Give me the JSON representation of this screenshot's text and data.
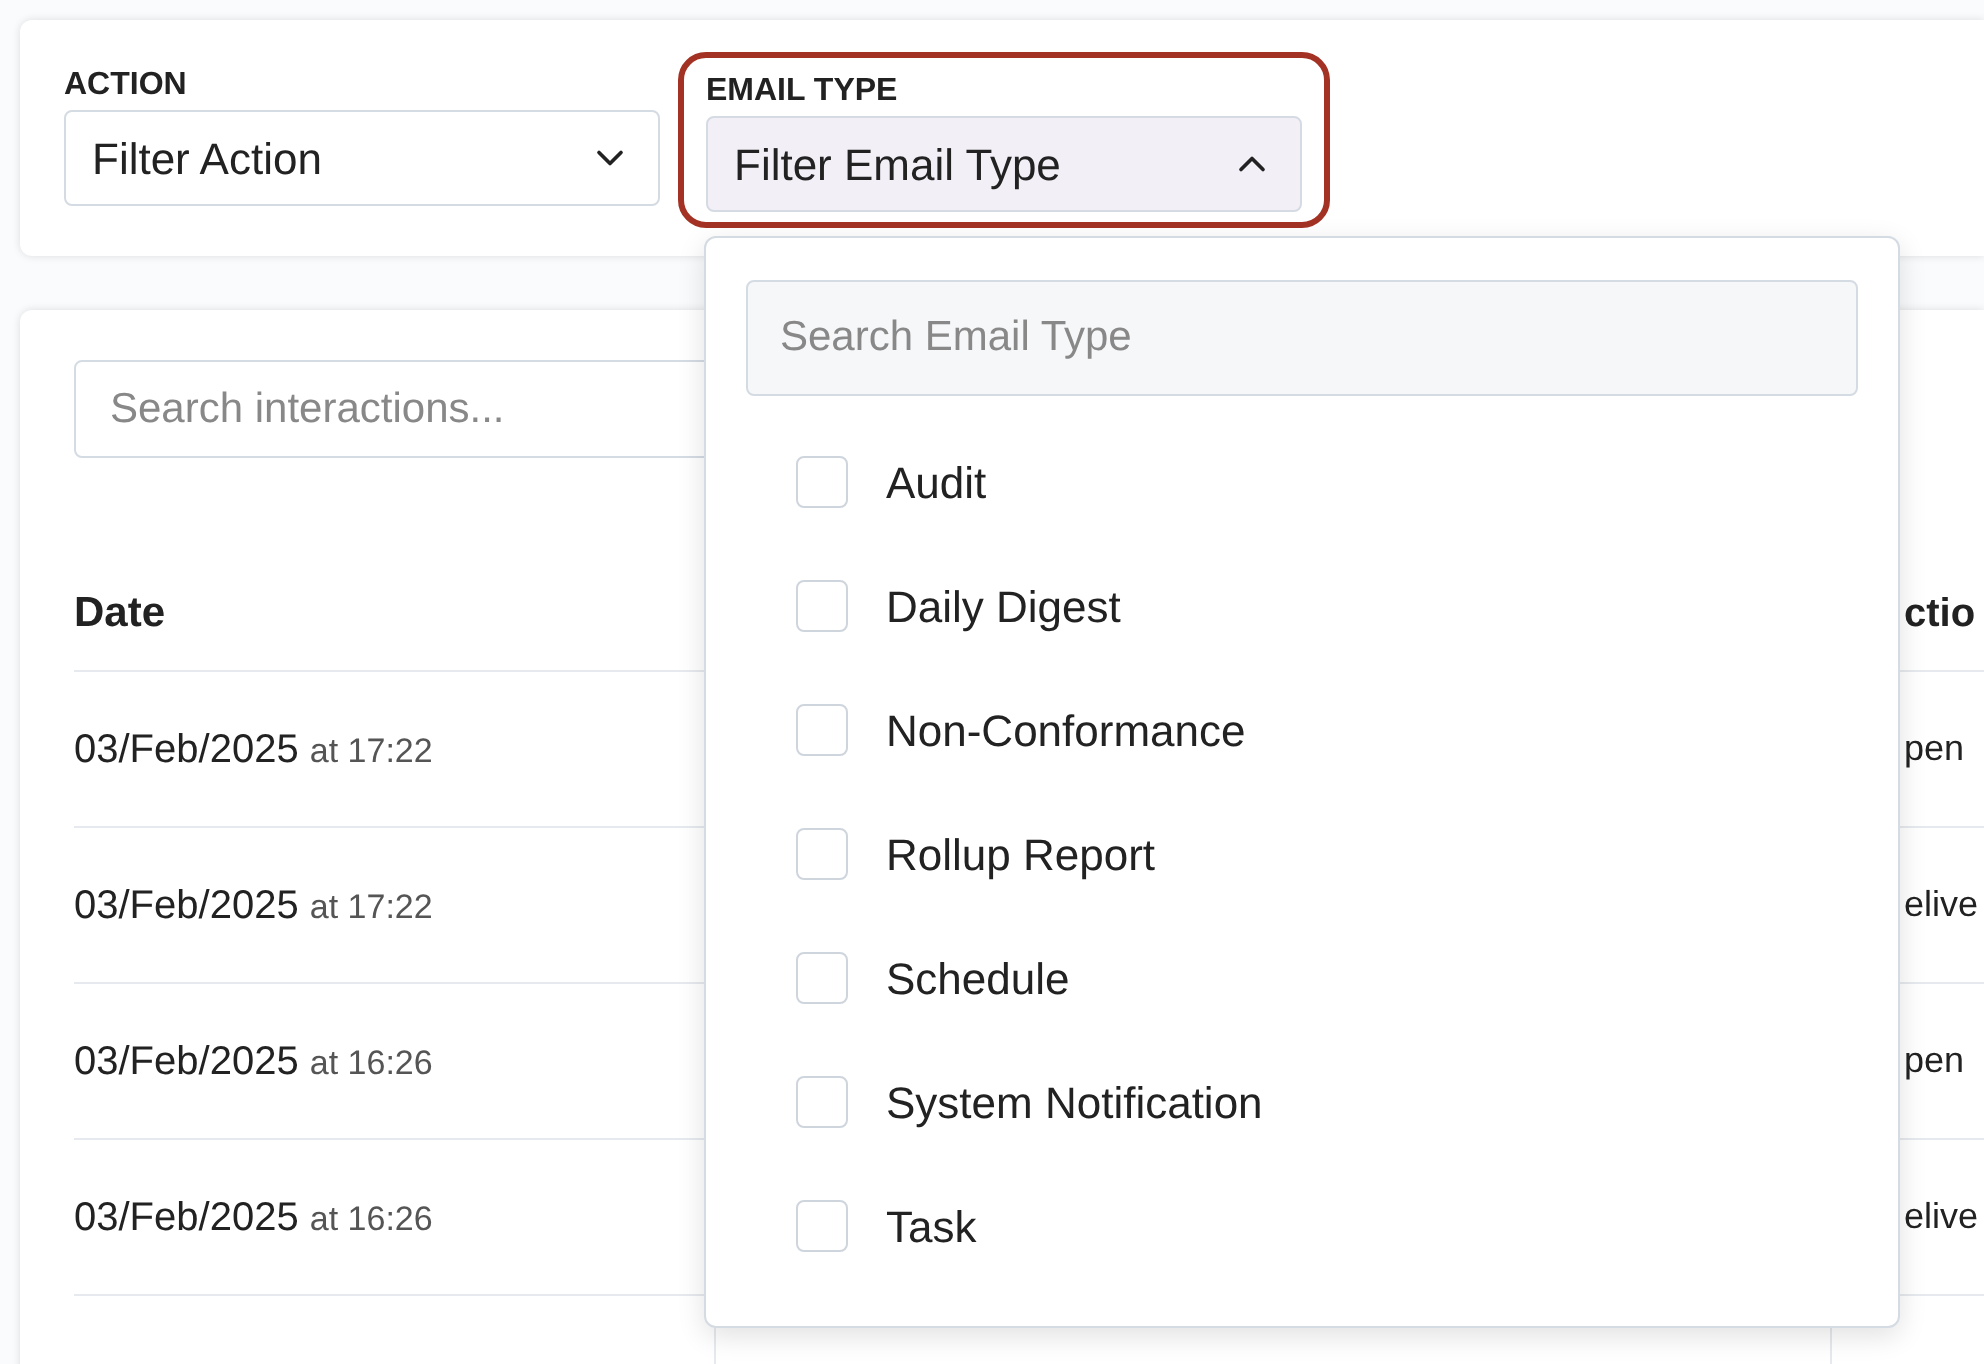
{
  "filters": [
    {
      "label": "ACTION",
      "placeholder": "Filter Action",
      "expanded": false,
      "highlighted": false
    },
    {
      "label": "EMAIL TYPE",
      "placeholder": "Filter Email Type",
      "expanded": true,
      "highlighted": true
    }
  ],
  "search": {
    "placeholder": "Search interactions..."
  },
  "table": {
    "columns": [
      {
        "label": "Date"
      },
      {
        "label": "ctio"
      }
    ],
    "rows": [
      {
        "date": "03/Feb/2025",
        "time": "at 17:22",
        "column_3": "pen"
      },
      {
        "date": "03/Feb/2025",
        "time": "at 17:22",
        "column_3": "elive"
      },
      {
        "date": "03/Feb/2025",
        "time": "at 16:26",
        "column_3": "pen"
      },
      {
        "date": "03/Feb/2025",
        "time": "at 16:26",
        "column_3": "elive"
      }
    ]
  },
  "dropdown": {
    "search_placeholder": "Search Email Type",
    "options": [
      {
        "label": "Audit",
        "checked": false
      },
      {
        "label": "Daily Digest",
        "checked": false
      },
      {
        "label": "Non-Conformance",
        "checked": false
      },
      {
        "label": "Rollup Report",
        "checked": false
      },
      {
        "label": "Schedule",
        "checked": false
      },
      {
        "label": "System Notification",
        "checked": false
      },
      {
        "label": "Task",
        "checked": false
      }
    ]
  }
}
